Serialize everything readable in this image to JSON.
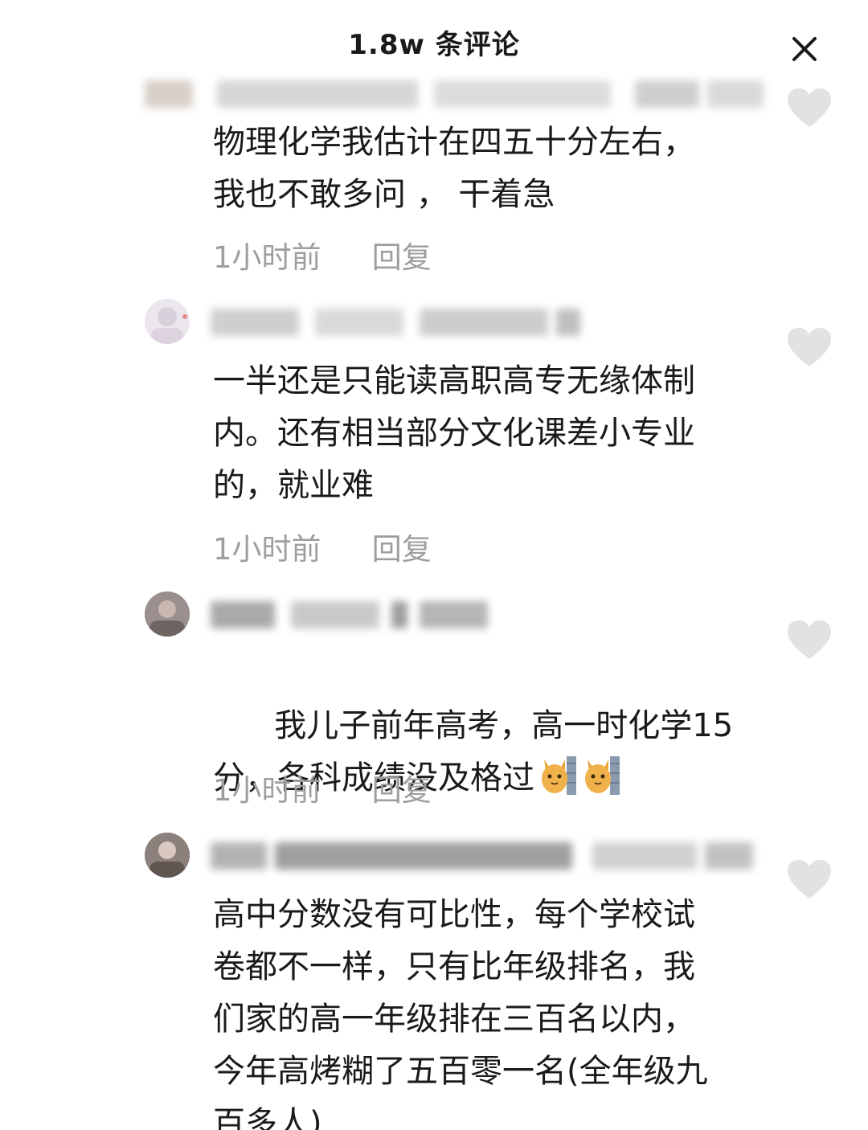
{
  "header": {
    "title": "1.8w 条评论"
  },
  "icons": {
    "close": "close-icon",
    "like": "heart-icon",
    "emoji": "cat-emoji-icon"
  },
  "colors": {
    "text": "#1a1a1a",
    "meta": "#9e9e9e",
    "like_icon": "#e2e2e2"
  },
  "comments": [
    {
      "text": "物理化学我估计在四五十分左右，\n我也不敢多问 ， 干着急",
      "time": "1小时前",
      "reply_label": "回复"
    },
    {
      "text": "一半还是只能读高职高专无缘体制\n内。还有相当部分文化课差小专业\n的，就业难",
      "time": "1小时前",
      "reply_label": "回复"
    },
    {
      "text": "我儿子前年高考，高一时化学15\n分，各科成绩没及格过",
      "time": "1小时前",
      "reply_label": "回复"
    },
    {
      "text": "高中分数没有可比性，每个学校试\n卷都不一样，只有比年级排名，我\n们家的高一年级排在三百名以内，\n今年高烤糊了五百零一名(全年级九\n百多人)",
      "time": "",
      "reply_label": ""
    }
  ]
}
